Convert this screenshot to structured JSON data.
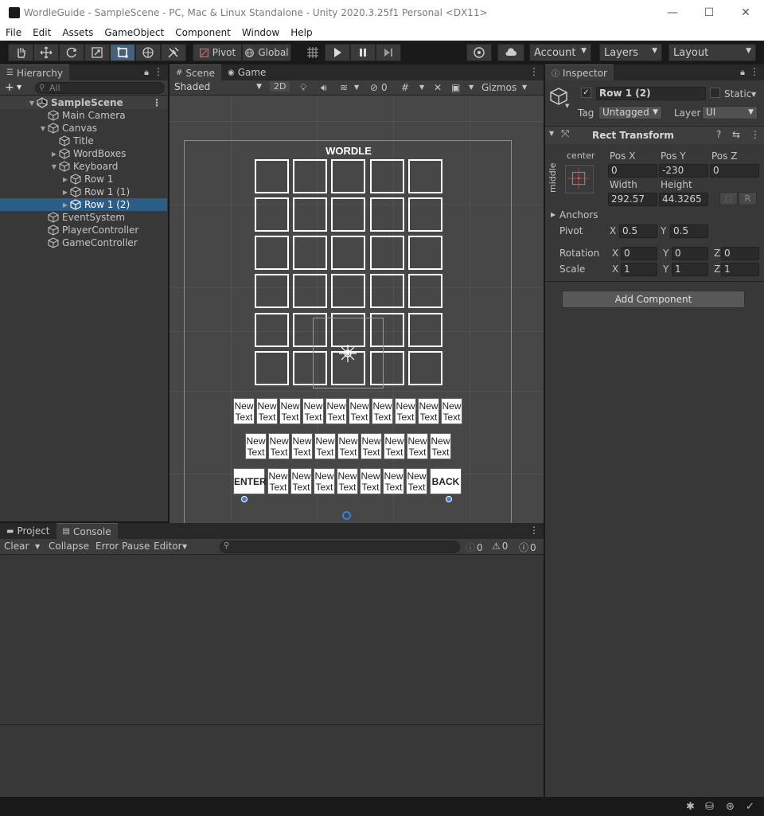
{
  "window": {
    "title": "WordleGuide - SampleScene - PC, Mac & Linux Standalone - Unity 2020.3.25f1 Personal <DX11>",
    "minimize": "—",
    "maximize": "☐",
    "close": "✕"
  },
  "menu": [
    "File",
    "Edit",
    "Assets",
    "GameObject",
    "Component",
    "Window",
    "Help"
  ],
  "toolbar": {
    "pivot": "Pivot",
    "global": "Global",
    "account": "Account",
    "layers": "Layers",
    "layout": "Layout"
  },
  "hierarchy": {
    "tab": "Hierarchy",
    "search_placeholder": "All",
    "items": [
      {
        "label": "SampleScene"
      },
      {
        "label": "Main Camera"
      },
      {
        "label": "Canvas"
      },
      {
        "label": "Title"
      },
      {
        "label": "WordBoxes"
      },
      {
        "label": "Keyboard"
      },
      {
        "label": "Row 1"
      },
      {
        "label": "Row 1 (1)"
      },
      {
        "label": "Row 1 (2)"
      },
      {
        "label": "EventSystem"
      },
      {
        "label": "PlayerController"
      },
      {
        "label": "GameController"
      }
    ]
  },
  "scene": {
    "tabs": [
      "Scene",
      "Game"
    ],
    "shading": "Shaded",
    "mode_2d": "2D",
    "hidden_count": "0",
    "gizmos": "Gizmos",
    "wordle_title": "WORDLE",
    "key_label": "New Text",
    "enter": "ENTER",
    "back": "BACK"
  },
  "console": {
    "tabs": [
      "Project",
      "Console"
    ],
    "clear": "Clear",
    "collapse": "Collapse",
    "error_pause": "Error Pause",
    "editor": "Editor",
    "info_count": "0",
    "warn_count": "0",
    "error_count": "0"
  },
  "inspector": {
    "tab": "Inspector",
    "object_name": "Row 1 (2)",
    "static_label": "Static",
    "tag_label": "Tag",
    "tag_value": "Untagged",
    "layer_label": "Layer",
    "layer_value": "UI",
    "component": "Rect Transform",
    "anchor_h": "center",
    "anchor_v": "middle",
    "pos_x_label": "Pos X",
    "pos_y_label": "Pos Y",
    "pos_z_label": "Pos Z",
    "pos_x": "0",
    "pos_y": "-230",
    "pos_z": "0",
    "width_label": "Width",
    "height_label": "Height",
    "width": "292.57",
    "height": "44.3265",
    "r_button": "R",
    "anchors": "Anchors",
    "pivot_label": "Pivot",
    "pivot_x": "0.5",
    "pivot_y": "0.5",
    "rotation_label": "Rotation",
    "rot_x": "0",
    "rot_y": "0",
    "rot_z": "0",
    "scale_label": "Scale",
    "scale_x": "1",
    "scale_y": "1",
    "scale_z": "1",
    "x": "X",
    "y": "Y",
    "z": "Z",
    "add_component": "Add Component"
  }
}
